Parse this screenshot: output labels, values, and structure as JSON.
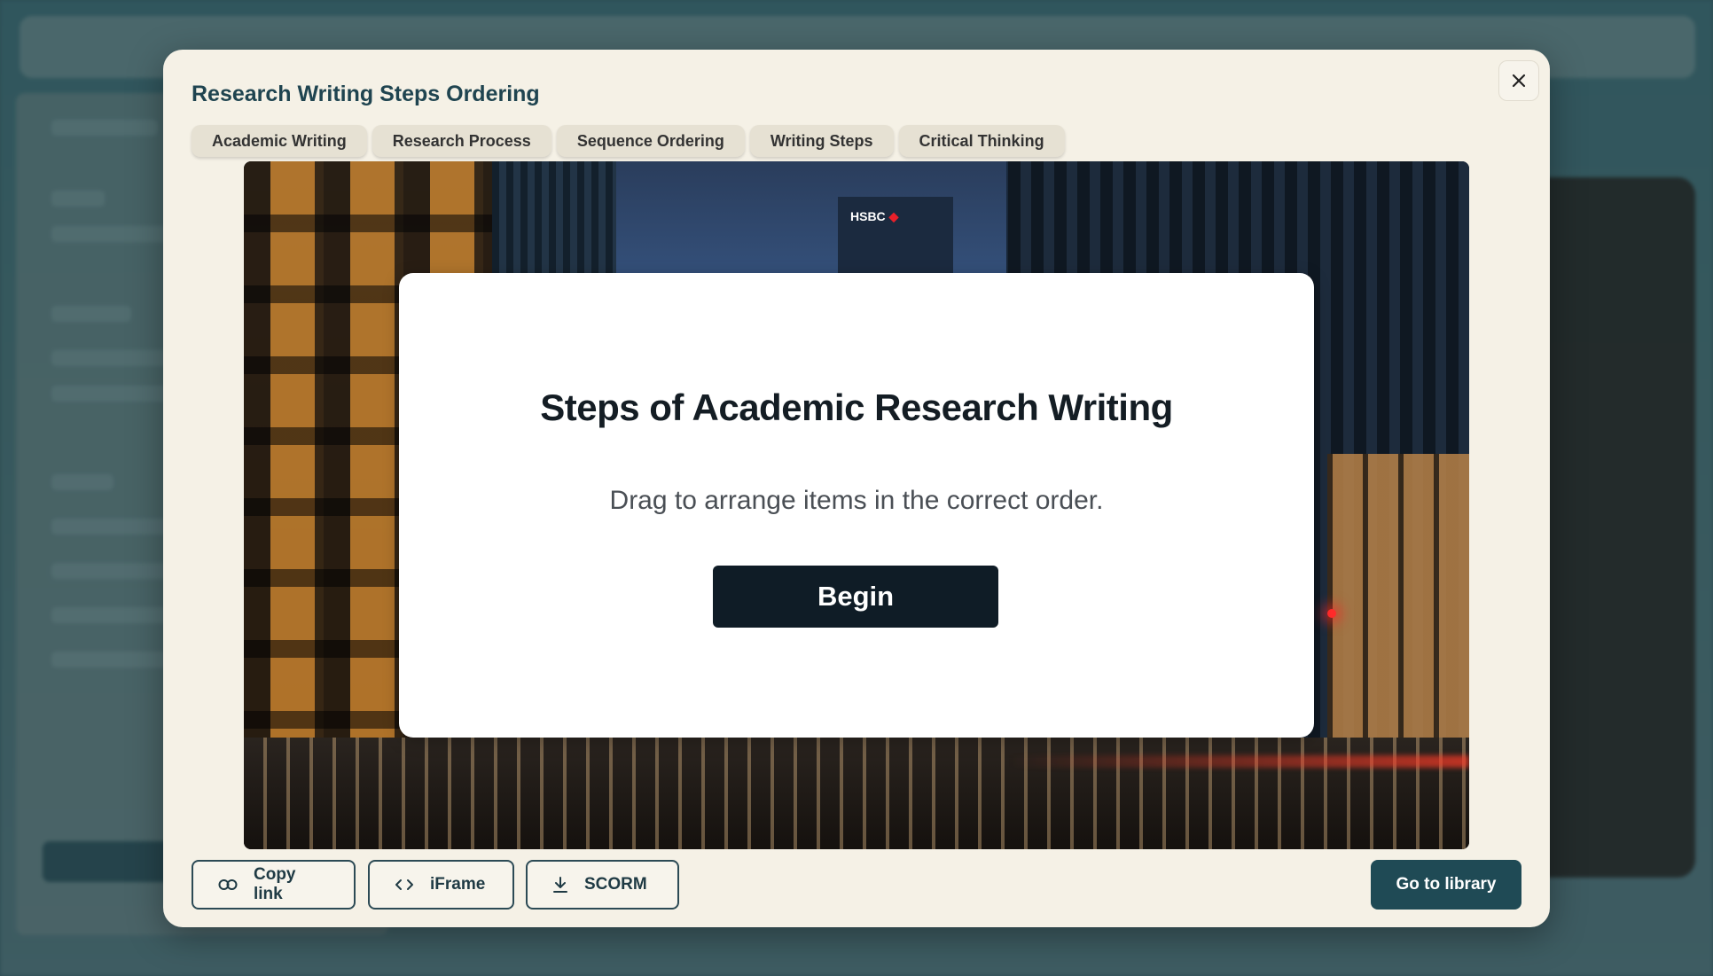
{
  "modal": {
    "title": "Research Writing Steps Ordering",
    "close_icon": "close-icon"
  },
  "tabs": [
    {
      "label": "Academic Writing"
    },
    {
      "label": "Research Process"
    },
    {
      "label": "Sequence Ordering"
    },
    {
      "label": "Writing Steps"
    },
    {
      "label": "Critical Thinking"
    }
  ],
  "stage": {
    "background_sign": "HSBC",
    "intro": {
      "title": "Steps of Academic Research Writing",
      "subtitle": "Drag to arrange items in the correct order.",
      "begin_label": "Begin"
    }
  },
  "footer": {
    "copy_link": {
      "label": "Copy link",
      "icon": "link-icon"
    },
    "iframe": {
      "label": "iFrame",
      "icon": "code-icon"
    },
    "scorm": {
      "label": "SCORM",
      "icon": "download-icon"
    },
    "library": {
      "label": "Go to library"
    }
  },
  "colors": {
    "modal_bg": "#f5f1e6",
    "title": "#1f4450",
    "primary_dark": "#0f1c26",
    "accent": "#1f4a55"
  }
}
